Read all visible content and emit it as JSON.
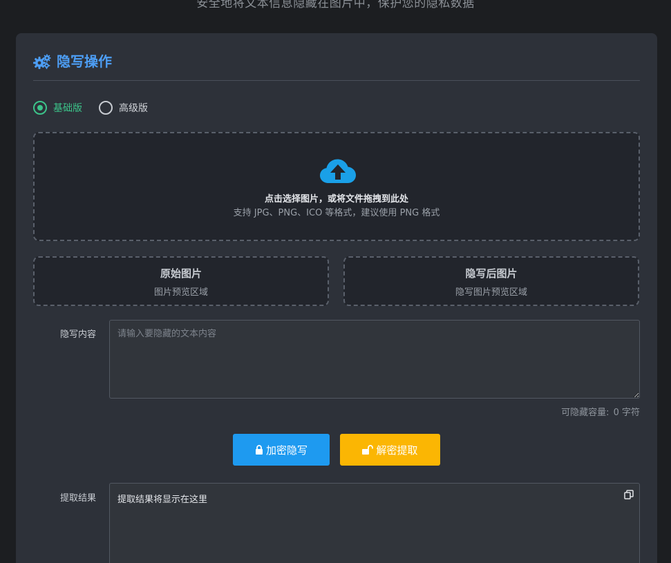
{
  "page": {
    "subtitle": "安全地将文本信息隐藏在图片中，保护您的隐私数据"
  },
  "card": {
    "title": "隐写操作",
    "title_icon": "gears-icon"
  },
  "mode": {
    "options": [
      {
        "label": "基础版",
        "checked": true
      },
      {
        "label": "高级版",
        "checked": false
      }
    ]
  },
  "upload": {
    "icon": "cloud-upload-icon",
    "main_text": "点击选择图片，或将文件拖拽到此处",
    "sub_text": "支持 JPG、PNG、ICO 等格式，建议使用 PNG 格式"
  },
  "previews": {
    "original": {
      "title": "原始图片",
      "placeholder": "图片预览区域"
    },
    "stego": {
      "title": "隐写后图片",
      "placeholder": "隐写图片预览区域"
    }
  },
  "hide_content": {
    "label": "隐写内容",
    "value": "",
    "placeholder": "请输入要隐藏的文本内容",
    "capacity_label": "可隐藏容量:",
    "capacity_value": "0 字符"
  },
  "actions": {
    "encrypt_label": "加密隐写",
    "encrypt_icon": "lock-icon",
    "decrypt_label": "解密提取",
    "decrypt_icon": "unlock-icon"
  },
  "result": {
    "label": "提取结果",
    "text": "提取结果将显示在这里",
    "copy_icon": "copy-icon"
  },
  "colors": {
    "accent_blue": "#4d9ef5",
    "success_green": "#3cc48a",
    "encrypt_button": "#1e9af0",
    "decrypt_button": "#fbb603",
    "cloud_icon": "#1aa0e8"
  }
}
